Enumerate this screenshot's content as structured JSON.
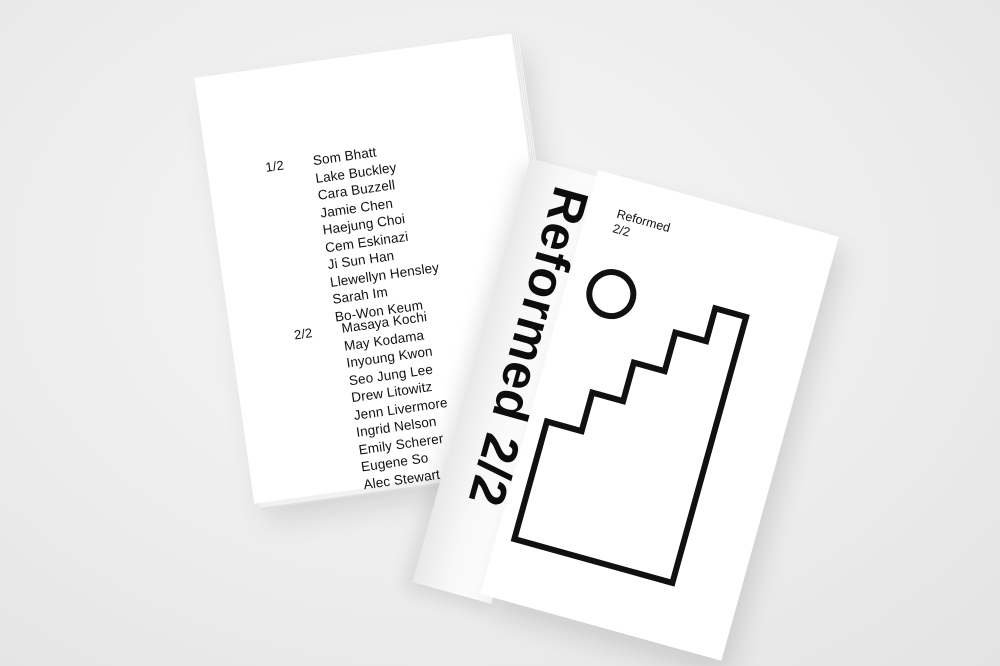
{
  "back_cover": {
    "group1": {
      "label": "1/2",
      "names": [
        "Som Bhatt",
        "Lake Buckley",
        "Cara Buzzell",
        "Jamie Chen",
        "Haejung Choi",
        "Cem Eskinazi",
        "Ji Sun Han",
        "Llewellyn Hensley",
        "Sarah Im",
        "Bo-Won Keum"
      ]
    },
    "group2": {
      "label": "2/2",
      "names": [
        "Masaya Kochi",
        "May Kodama",
        "Inyoung Kwon",
        "Seo Jung Lee",
        "Drew Litowitz",
        "Jenn Livermore",
        "Ingrid Nelson",
        "Emily Scherer",
        "Eugene So",
        "Alec Stewart"
      ]
    }
  },
  "spine": {
    "title": "Reformed 2/2"
  },
  "front_cover": {
    "title": "Reformed",
    "subtitle": "2/2",
    "art": "circle-and-stairs-outline"
  },
  "colors": {
    "ink": "#111111",
    "paper": "#ffffff",
    "background": "#eeeeee"
  }
}
